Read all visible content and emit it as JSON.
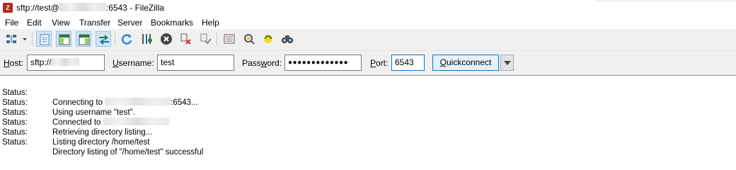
{
  "window": {
    "title_prefix": "sftp://test@",
    "title_suffix": ":6543 - FileZilla"
  },
  "menu": [
    "File",
    "Edit",
    "View",
    "Transfer",
    "Server",
    "Bookmarks",
    "Help"
  ],
  "toolbar": {
    "buttons": [
      "site-manager-icon",
      "dropdown-arrow-icon",
      "message-log-toggle-icon",
      "local-tree-toggle-icon",
      "remote-tree-toggle-icon",
      "transfer-queue-toggle-icon",
      "refresh-icon",
      "process-queue-icon",
      "cancel-icon",
      "disconnect-icon",
      "reconnect-icon",
      "filter-icon",
      "compare-icon",
      "sync-browsing-icon",
      "search-icon"
    ]
  },
  "quickconnect": {
    "host_label": "Host:",
    "host_value": "sftp://",
    "username_label": "Username:",
    "username_value": "test",
    "password_label": "Password:",
    "password_value": "●●●●●●●●●●●●●",
    "port_label": "Port:",
    "port_value": "6543",
    "button_label": "Quickconnect"
  },
  "log": [
    {
      "type": "Status:",
      "message": "Connecting to ",
      "after": ":6543...",
      "redacted": true
    },
    {
      "type": "Status:",
      "message": "Using username \"test\"."
    },
    {
      "type": "Status:",
      "message": "Connected to ",
      "redacted": true
    },
    {
      "type": "Status:",
      "message": "Retrieving directory listing..."
    },
    {
      "type": "Status:",
      "message": "Listing directory /home/test"
    },
    {
      "type": "Status:",
      "message": "Directory listing of \"/home/test\" successful"
    }
  ],
  "colors": {
    "accent": "#0078d7",
    "pressed_bg": "#cce4f7",
    "toolbar_bg": "#f0f0f0",
    "app_icon": "#b5271d"
  }
}
